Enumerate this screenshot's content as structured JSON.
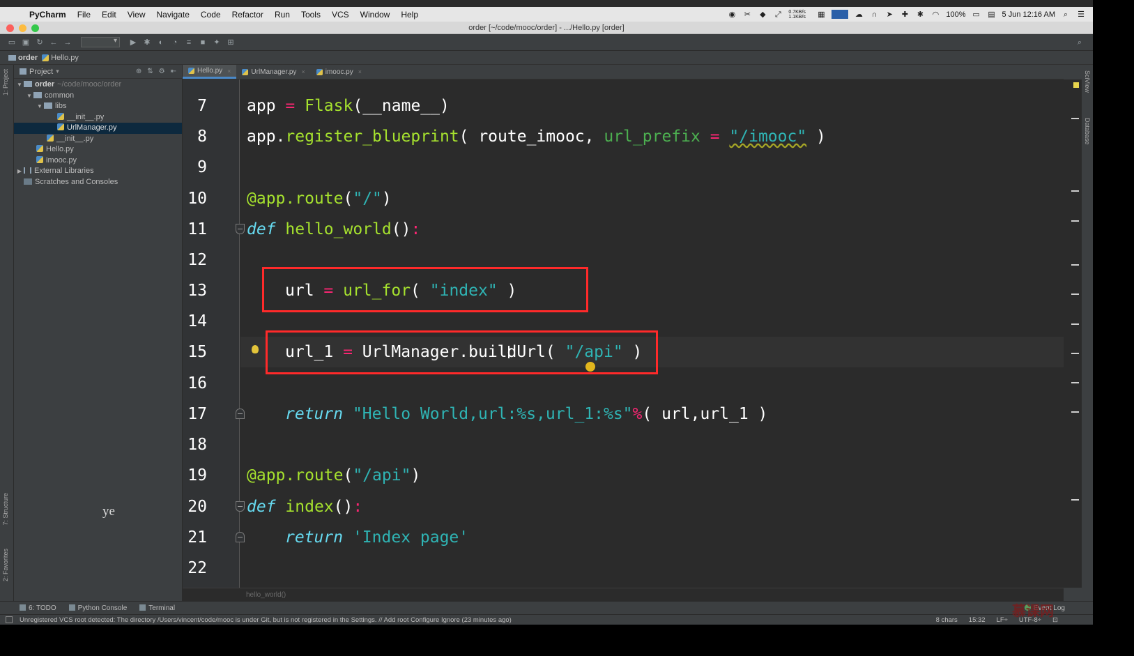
{
  "menubar": {
    "app": "PyCharm",
    "items": [
      "File",
      "Edit",
      "View",
      "Navigate",
      "Code",
      "Refactor",
      "Run",
      "Tools",
      "VCS",
      "Window",
      "Help"
    ],
    "net_speed": "0.7KB/s 1.1KB/s",
    "battery": "100%",
    "datetime": "5 Jun 12:16 AM"
  },
  "window": {
    "title": "order [~/code/mooc/order] - .../Hello.py [order]"
  },
  "navbar": {
    "crumbs": [
      "order",
      "Hello.py"
    ]
  },
  "project_panel": {
    "header": "Project",
    "tree": [
      {
        "label": "order",
        "path": "~/code/mooc/order",
        "type": "folder",
        "expanded": true
      },
      {
        "label": "common",
        "type": "folder",
        "expanded": true
      },
      {
        "label": "libs",
        "type": "folder",
        "expanded": true
      },
      {
        "label": "__init__.py",
        "type": "py"
      },
      {
        "label": "UrlManager.py",
        "type": "py",
        "selected": true
      },
      {
        "label": "__init__.py",
        "type": "py"
      },
      {
        "label": "Hello.py",
        "type": "py"
      },
      {
        "label": "imooc.py",
        "type": "py"
      },
      {
        "label": "External Libraries",
        "type": "lib",
        "expanded": false
      },
      {
        "label": "Scratches and Consoles",
        "type": "scratch"
      }
    ],
    "overlay_text": "ye"
  },
  "left_strip": {
    "project_tab": "1: Project",
    "structure_tab": "7: Structure",
    "favorites_tab": "2: Favorites"
  },
  "right_strip": {
    "sciview": "SciView",
    "database": "Database"
  },
  "tabs": [
    {
      "label": "Hello.py",
      "active": true
    },
    {
      "label": "UrlManager.py",
      "active": false
    },
    {
      "label": "imooc.py",
      "active": false
    }
  ],
  "editor": {
    "line_numbers": [
      "7",
      "8",
      "9",
      "10",
      "11",
      "12",
      "13",
      "14",
      "15",
      "16",
      "17",
      "18",
      "19",
      "20",
      "21",
      "22"
    ],
    "current_line": "15",
    "breadcrumb": "hello_world()"
  },
  "code": {
    "l7": {
      "a": "app ",
      "op": "=",
      "b": " ",
      "fn": "Flask",
      "c": "(__name__)"
    },
    "l8": {
      "a": "app.",
      "fn": "register_blueprint",
      "b": "( route_imooc, ",
      "param": "url_prefix",
      "c": " ",
      "op": "=",
      "d": " ",
      "str": "\"/imooc\"",
      "e": " )"
    },
    "l10": {
      "dec": "@app.route",
      "a": "(",
      "str": "\"/\"",
      "b": ")"
    },
    "l11": {
      "kw": "def",
      "a": " ",
      "fn": "hello_world",
      "b": "()",
      "op": ":"
    },
    "l13": {
      "a": "url ",
      "op": "=",
      "b": " ",
      "fn": "url_for",
      "c": "( ",
      "str": "\"index\"",
      "d": " )"
    },
    "l15": {
      "a": "url_1 ",
      "op": "=",
      "b": " UrlManager.",
      "fn": "buildUrl",
      "c": "( ",
      "str": "\"/api\"",
      "d": " )"
    },
    "l17": {
      "kw": "return",
      "a": " ",
      "str": "\"Hello World,url:%s,url_1:%s\"",
      "op": "%",
      "b": "( url,url_1 )"
    },
    "l19": {
      "dec": "@app.route",
      "a": "(",
      "str": "\"/api\"",
      "b": ")"
    },
    "l20": {
      "kw": "def",
      "a": " ",
      "fn": "index",
      "b": "()",
      "op": ":"
    },
    "l21": {
      "kw": "return",
      "a": " ",
      "str": "'Index page'"
    }
  },
  "toolwindows": {
    "todo": "6: TODO",
    "python_console": "Python Console",
    "terminal": "Terminal",
    "event_log": "Event Log"
  },
  "statusbar": {
    "message": "Unregistered VCS root detected: The directory /Users/vincent/code/mooc is under Git, but is not registered in the Settings. // Add root  Configure  Ignore (23 minutes ago)",
    "chars": "8 chars",
    "position": "15:32",
    "line_sep": "LF÷",
    "encoding": "UTF-8÷"
  },
  "colors": {
    "highlight_box": "#ff2a2a",
    "keyword": "#66d9ef",
    "function": "#a6e22e",
    "string": "#2fb4b4",
    "operator": "#f92672"
  }
}
